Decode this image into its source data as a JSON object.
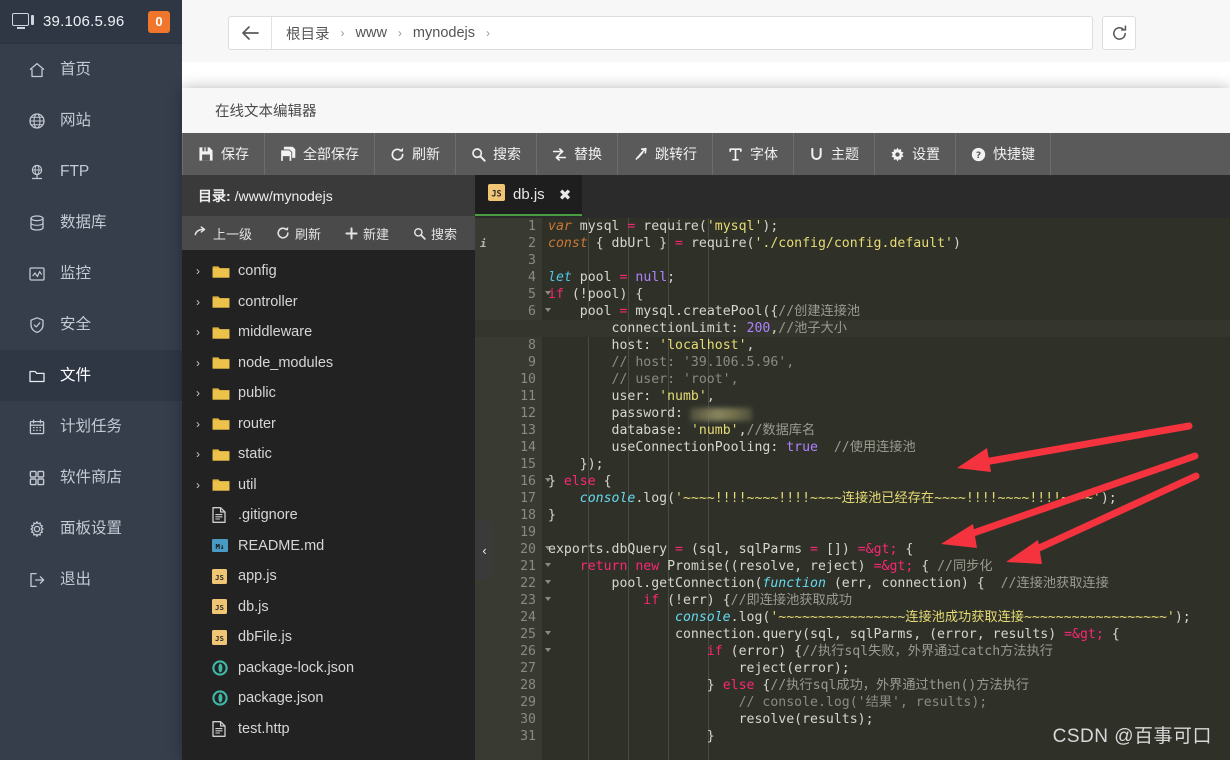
{
  "sidebar": {
    "ip": "39.106.5.96",
    "badge": "0",
    "items": [
      {
        "label": "首页",
        "icon": "home-icon"
      },
      {
        "label": "网站",
        "icon": "globe-icon"
      },
      {
        "label": "FTP",
        "icon": "ftp-icon"
      },
      {
        "label": "数据库",
        "icon": "database-icon"
      },
      {
        "label": "监控",
        "icon": "monitor-chart-icon"
      },
      {
        "label": "安全",
        "icon": "shield-icon"
      },
      {
        "label": "文件",
        "icon": "folder-icon"
      },
      {
        "label": "计划任务",
        "icon": "calendar-icon"
      },
      {
        "label": "软件商店",
        "icon": "grid-icon"
      },
      {
        "label": "面板设置",
        "icon": "gear-icon"
      },
      {
        "label": "退出",
        "icon": "logout-icon"
      }
    ],
    "active_index": 6
  },
  "topbar": {
    "back_icon": "arrow-left-icon",
    "refresh_icon": "refresh-icon",
    "breadcrumbs": [
      "根目录",
      "www",
      "mynodejs"
    ],
    "separator": "›"
  },
  "editor": {
    "window_title": "在线文本编辑器",
    "toolbar": [
      {
        "label": "保存",
        "icon": "save-icon"
      },
      {
        "label": "全部保存",
        "icon": "save-all-icon"
      },
      {
        "label": "刷新",
        "icon": "refresh-icon"
      },
      {
        "label": "搜索",
        "icon": "search-icon"
      },
      {
        "label": "替换",
        "icon": "replace-icon"
      },
      {
        "label": "跳转行",
        "icon": "goto-line-icon"
      },
      {
        "label": "字体",
        "icon": "font-icon"
      },
      {
        "label": "主题",
        "icon": "theme-icon"
      },
      {
        "label": "设置",
        "icon": "gear-icon"
      },
      {
        "label": "快捷键",
        "icon": "help-icon"
      }
    ],
    "tab": {
      "name": "db.js",
      "icon": "js-file-icon",
      "close": "✖"
    }
  },
  "tree": {
    "dir_label": "目录:",
    "dir_path": "/www/mynodejs",
    "ops": [
      {
        "label": "上一级",
        "icon": "arrow-up-level-icon"
      },
      {
        "label": "刷新",
        "icon": "refresh-icon"
      },
      {
        "label": "新建",
        "icon": "plus-icon"
      },
      {
        "label": "搜索",
        "icon": "search-icon"
      }
    ],
    "items": [
      {
        "name": "config",
        "type": "folder"
      },
      {
        "name": "controller",
        "type": "folder"
      },
      {
        "name": "middleware",
        "type": "folder"
      },
      {
        "name": "node_modules",
        "type": "folder"
      },
      {
        "name": "public",
        "type": "folder"
      },
      {
        "name": "router",
        "type": "folder"
      },
      {
        "name": "static",
        "type": "folder"
      },
      {
        "name": "util",
        "type": "folder"
      },
      {
        "name": ".gitignore",
        "type": "file"
      },
      {
        "name": "README.md",
        "type": "md"
      },
      {
        "name": "app.js",
        "type": "js"
      },
      {
        "name": "db.js",
        "type": "js"
      },
      {
        "name": "dbFile.js",
        "type": "js"
      },
      {
        "name": "package-lock.json",
        "type": "json"
      },
      {
        "name": "package.json",
        "type": "json"
      },
      {
        "name": "test.http",
        "type": "file"
      }
    ],
    "collapse_handle": "‹"
  },
  "code": {
    "first_line": 1,
    "last_line": 31,
    "highlighted_line": 7,
    "warning_line": 2,
    "fold_lines": [
      5,
      6,
      16,
      20,
      21,
      22,
      23,
      25,
      26
    ],
    "lines": [
      "var mysql = require('mysql');",
      "const { dbUrl } = require('./config/config.default')",
      "",
      "let pool = null;",
      "if (!pool) {",
      "    pool = mysql.createPool({//创建连接池",
      "        connectionLimit: 200,//池子大小",
      "        host: 'localhost',",
      "        // host: '39.106.5.96',",
      "        // user: 'root',",
      "        user: 'numb',",
      "        password: ",
      "        database: 'numb',//数据库名",
      "        useConnectionPooling: true  //使用连接池",
      "    });",
      "} else {",
      "    console.log('~~~~!!!!~~~~!!!!~~~~连接池已经存在~~~~!!!!~~~~!!!!~~~~');",
      "}",
      "",
      "exports.dbQuery = (sql, sqlParms = []) => {",
      "    return new Promise((resolve, reject) => { //同步化",
      "        pool.getConnection(function (err, connection) {  //连接池获取连接",
      "            if (!err) {//即连接池获取成功",
      "                console.log('~~~~~~~~~~~~~~~~连接池成功获取连接~~~~~~~~~~~~~~~~~~');",
      "                connection.query(sql, sqlParms, (error, results) => {",
      "                    if (error) {//执行sql失败，外界通过catch方法执行",
      "                        reject(error);",
      "                    } else {//执行sql成功，外界通过then()方法执行",
      "                        // console.log('结果', results);",
      "                        resolve(results);",
      "                    }"
    ]
  },
  "annotations": {
    "arrow_color": "#f5333f",
    "arrow_count": 3,
    "password_redacted": true
  },
  "watermark": "CSDN @百事可口",
  "colors": {
    "sidebar_bg": "#363e4c",
    "sidebar_active": "#2f3744",
    "badge": "#f0762b",
    "toolbar_bg": "#5a5a5a",
    "tree_bg": "#222222",
    "code_bg": "#2f3129",
    "tab_accent": "#4b9e3f"
  }
}
